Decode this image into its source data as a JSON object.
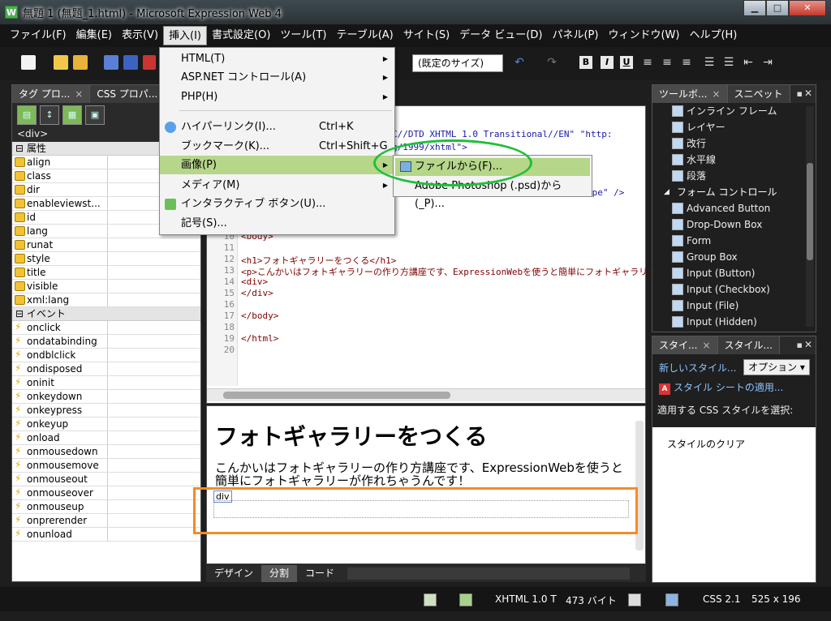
{
  "window": {
    "title": "無題 1 (無題_1.html) - Microsoft Expression Web 4",
    "icon_letter": "W"
  },
  "menubar": [
    "ファイル(F)",
    "編集(E)",
    "表示(V)",
    "挿入(I)",
    "書式設定(O)",
    "ツール(T)",
    "テーブル(A)",
    "サイト(S)",
    "データ ビュー(D)",
    "パネル(P)",
    "ウィンドウ(W)",
    "ヘルプ(H)"
  ],
  "toolbar": {
    "size_combo": "(既定のサイズ)",
    "bold": "B",
    "italic": "I",
    "underline": "U"
  },
  "insert_menu": {
    "items": [
      {
        "label": "HTML(T)",
        "arrow": true
      },
      {
        "label": "ASP.NET コントロール(A)",
        "arrow": true
      },
      {
        "label": "PHP(H)",
        "arrow": true
      },
      {
        "label": "ハイパーリンク(I)...",
        "shortcut": "Ctrl+K"
      },
      {
        "label": "ブックマーク(K)...",
        "shortcut": "Ctrl+Shift+G"
      },
      {
        "label": "画像(P)",
        "arrow": true
      },
      {
        "label": "メディア(M)",
        "arrow": true
      },
      {
        "label": "インタラクティブ ボタン(U)..."
      },
      {
        "label": "記号(S)..."
      }
    ],
    "submenu": [
      "ファイルから(F)...",
      "Adobe Photoshop (.psd)から(_P)..."
    ]
  },
  "left_panel": {
    "tabs": [
      "タグ プロ...",
      "CSS プロパ..."
    ],
    "current_tag": "<div>",
    "attributes_group": "属性",
    "attributes": [
      "align",
      "class",
      "dir",
      "enableviewst...",
      "id",
      "lang",
      "runat",
      "style",
      "title",
      "visible",
      "xml:lang"
    ],
    "events_group": "イベント",
    "events": [
      "onclick",
      "ondatabinding",
      "ondblclick",
      "ondisposed",
      "oninit",
      "onkeydown",
      "onkeypress",
      "onkeyup",
      "onload",
      "onmousedown",
      "onmousemove",
      "onmouseout",
      "onmouseover",
      "onmouseup",
      "onprerender",
      "onunload"
    ]
  },
  "code": {
    "line1_frag": "C//DTD XHTML 1.0 Transitional//EN\" \"http:",
    "line2_frag": "g/1999/xhtml\">",
    "line3_frag": "ype\" />",
    "lines": [
      {
        "n": "10",
        "text": "<body>"
      },
      {
        "n": "11",
        "text": ""
      },
      {
        "n": "12",
        "text": "<h1>フォトギャラリーをつくる</h1>"
      },
      {
        "n": "13",
        "text": "<p>こんかいはフォトギャラリーの作り方講座です、ExpressionWebを使うと簡単にフォトギャラリーが作れ"
      },
      {
        "n": "14",
        "text": "<div>"
      },
      {
        "n": "15",
        "text": "</div>"
      },
      {
        "n": "16",
        "text": ""
      },
      {
        "n": "17",
        "text": "</body>"
      },
      {
        "n": "18",
        "text": ""
      },
      {
        "n": "19",
        "text": "</html>"
      },
      {
        "n": "20",
        "text": ""
      }
    ]
  },
  "design": {
    "heading": "フォトギャラリーをつくる",
    "paragraph": "こんかいはフォトギャラリーの作り方講座です、ExpressionWebを使うと簡単にフォトギャラリーが作れちゃうんです！",
    "div_label": "div"
  },
  "view_tabs": [
    "デザイン",
    "分割",
    "コード"
  ],
  "toolbox": {
    "tabs": [
      "ツールボ...",
      "スニペット"
    ],
    "items": [
      {
        "label": "インライン フレーム"
      },
      {
        "label": "レイヤー"
      },
      {
        "label": "改行"
      },
      {
        "label": "水平線"
      },
      {
        "label": "段落"
      },
      {
        "label": "フォーム コントロール",
        "group": true
      },
      {
        "label": "Advanced Button"
      },
      {
        "label": "Drop-Down Box"
      },
      {
        "label": "Form"
      },
      {
        "label": "Group Box"
      },
      {
        "label": "Input (Button)"
      },
      {
        "label": "Input (Checkbox)"
      },
      {
        "label": "Input (File)"
      },
      {
        "label": "Input (Hidden)"
      }
    ]
  },
  "styles_panel": {
    "tabs": [
      "スタイ...",
      "スタイル..."
    ],
    "new_style": "新しいスタイル...",
    "options": "オプション ▾",
    "attach": "スタイル シートの適用...",
    "select_label": "適用する CSS スタイルを選択:",
    "clear": "スタイルのクリア"
  },
  "statusbar": {
    "doctype": "XHTML 1.0 T",
    "size": "473 バイト",
    "css": "CSS 2.1",
    "dims": "525 x 196"
  }
}
